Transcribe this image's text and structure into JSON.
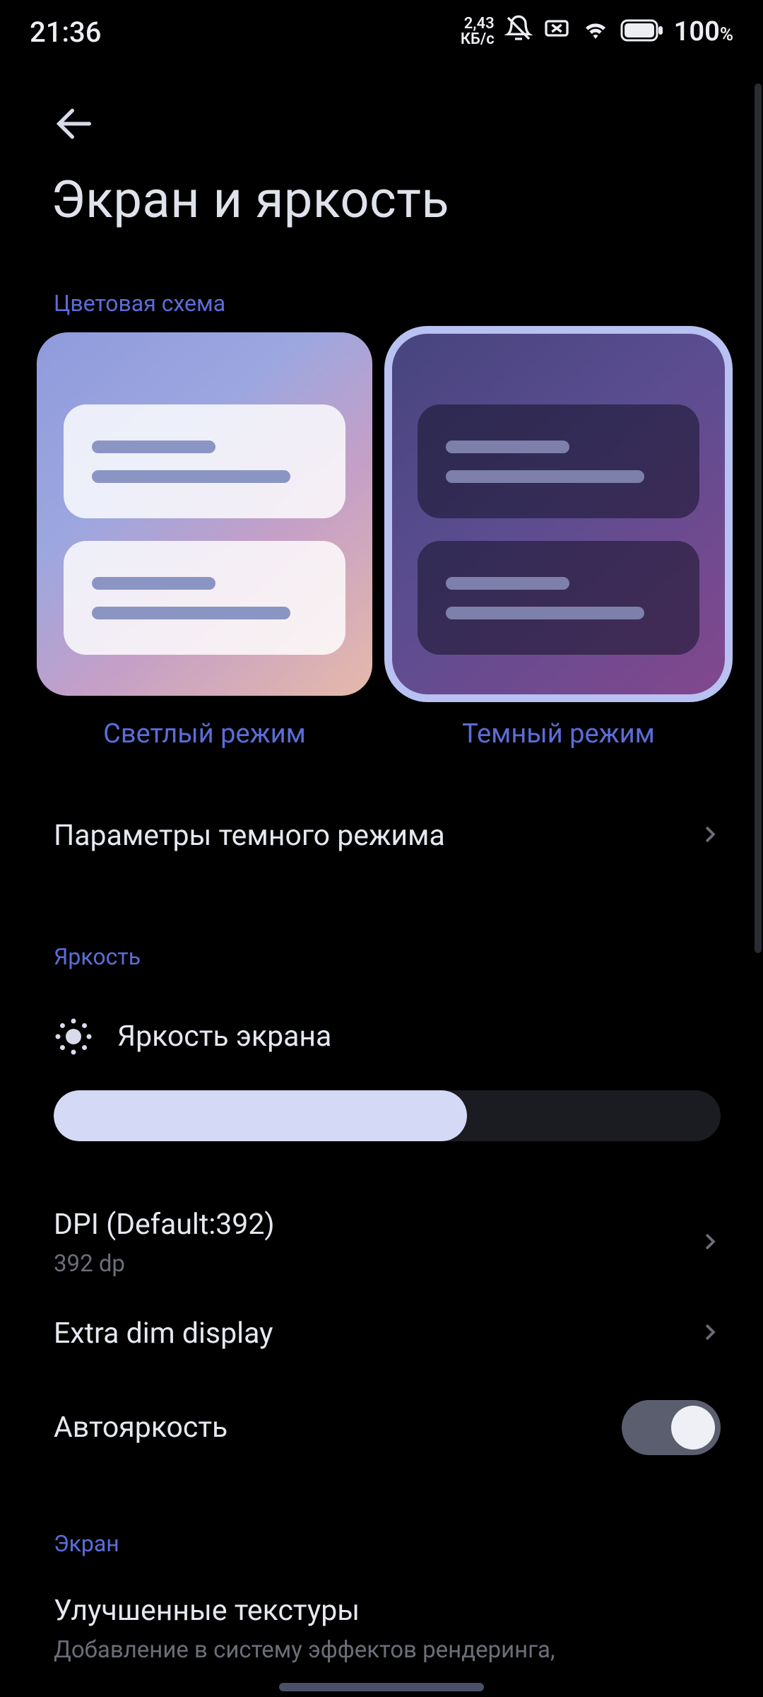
{
  "status": {
    "time": "21:36",
    "net_speed_top": "2,43",
    "net_speed_bot": "КБ/с",
    "battery_pct": "100",
    "battery_suffix": "%"
  },
  "page_title": "Экран и яркость",
  "sections": {
    "color_scheme": "Цветовая схема",
    "brightness": "Яркость",
    "screen": "Экран"
  },
  "schemes": {
    "light_label": "Светлый режим",
    "dark_label": "Темный режим"
  },
  "rows": {
    "dark_params": "Параметры темного режима",
    "brightness_title": "Яркость экрана",
    "dpi_title": "DPI (Default:392)",
    "dpi_sub": "392 dp",
    "extra_dim": "Extra dim display",
    "auto_brightness": "Автояркость",
    "textures_title": "Улучшенные текстуры",
    "textures_sub": "Добавление в систему эффектов рендеринга,"
  },
  "brightness_pct": 62
}
